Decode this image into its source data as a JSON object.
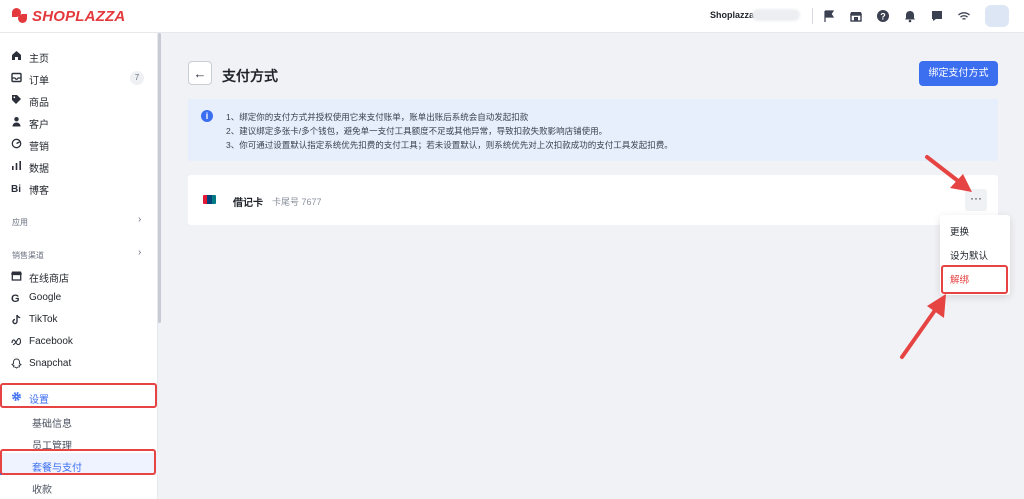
{
  "topbar": {
    "logo_text": "SHOPLAZZA",
    "store_name": "Shoplazza",
    "icons": [
      "flag-icon",
      "store-icon",
      "help-icon",
      "bell-icon",
      "chat-icon",
      "wifi-icon"
    ]
  },
  "sidebar": {
    "items": [
      {
        "label": "主页",
        "icon": "home-icon"
      },
      {
        "label": "订单",
        "icon": "order-icon",
        "badge": "7"
      },
      {
        "label": "商品",
        "icon": "tag-icon"
      },
      {
        "label": "客户",
        "icon": "user-icon"
      },
      {
        "label": "营销",
        "icon": "marketing-icon"
      },
      {
        "label": "数据",
        "icon": "chart-icon"
      },
      {
        "label": "博客",
        "icon": "blog-icon"
      }
    ],
    "apps_label": "应用",
    "sales_label": "销售渠道",
    "channels": [
      {
        "label": "在线商店",
        "icon": "store-icon"
      },
      {
        "label": "Google",
        "icon": "google-icon"
      },
      {
        "label": "TikTok",
        "icon": "tiktok-icon"
      },
      {
        "label": "Facebook",
        "icon": "meta-icon"
      },
      {
        "label": "Snapchat",
        "icon": "snapchat-icon"
      }
    ],
    "settings_label": "设置",
    "settings_sub": [
      "基础信息",
      "员工管理",
      "套餐与支付",
      "收款"
    ]
  },
  "main": {
    "back_icon": "arrow-left-icon",
    "title": "支付方式",
    "bind_button": "绑定支付方式",
    "notice": {
      "line1": "1、绑定你的支付方式并授权使用它来支付账单，账单出账后系统会自动发起扣款",
      "line2": "2、建议绑定多张卡/多个钱包，避免单一支付工具额度不足或其他异常，导致扣款失败影响店铺使用。",
      "line3": "3、你可通过设置默认指定系统优先扣费的支付工具；若未设置默认，则系统优先对上次扣款成功的支付工具发起扣费。"
    },
    "card": {
      "brand_icon": "unionpay-icon",
      "type": "借记卡",
      "tail": "卡尾号 7677",
      "more": "···"
    },
    "dropdown": [
      "更换",
      "设为默认",
      "解绑"
    ]
  },
  "colors": {
    "accent": "#3c6ef0",
    "danger": "#e64343",
    "brand": "#e4393c"
  }
}
